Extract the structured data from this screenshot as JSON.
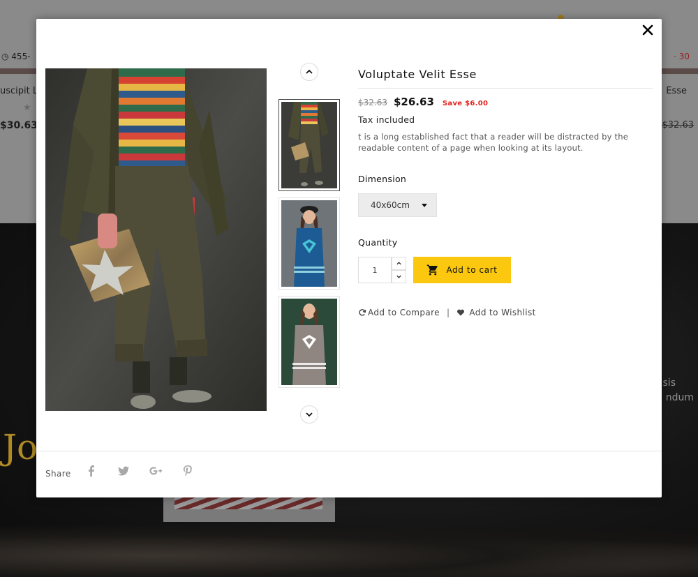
{
  "background": {
    "phone_text": "455-",
    "top_right_text": "· 30",
    "product_name_left": "uscipit L",
    "product_price_left": "$30.63",
    "product_name_right": "Esse",
    "product_price_right": "$32.63",
    "gold_text": "Jo",
    "side_text_1": "sis",
    "side_text_2": "ndum"
  },
  "modal": {
    "close_icon": "close-icon",
    "product": {
      "title": "Voluptate Velit Esse",
      "old_price": "$32.63",
      "price": "$26.63",
      "save_label": "Save $6.00",
      "tax_text": "Tax included",
      "description": "t is a long established fact that a reader will be distracted by the readable content of a page when looking at its layout."
    },
    "dimension": {
      "label": "Dimension",
      "selected": "40x60cm"
    },
    "quantity": {
      "label": "Quantity",
      "value": "1"
    },
    "add_to_cart_label": "Add to cart",
    "compare_label": "Add to Compare",
    "separator": "|",
    "wishlist_label": "Add to Wishlist",
    "share_label": "Share",
    "social_icons": [
      "facebook-icon",
      "twitter-icon",
      "google-plus-icon",
      "pinterest-icon"
    ],
    "colors": {
      "accent": "#fbc80f",
      "save": "#e3211b"
    }
  }
}
